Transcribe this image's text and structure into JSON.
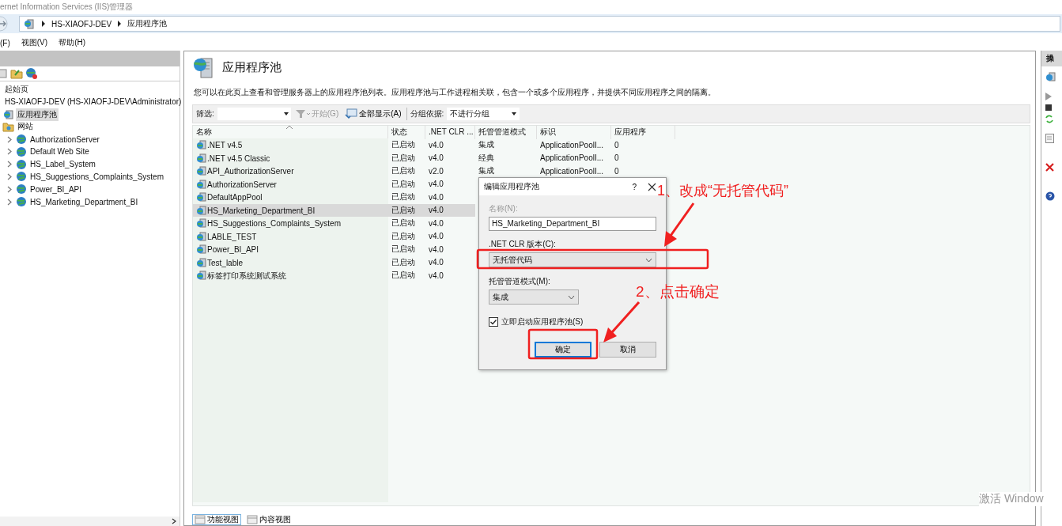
{
  "window": {
    "title": "ernet Information Services (IIS)管理器"
  },
  "address": {
    "segments": [
      "HS-XIAOFJ-DEV",
      "应用程序池"
    ]
  },
  "menu": [
    "(F)",
    "视图(V)",
    "帮助(H)"
  ],
  "tree": [
    {
      "label": "起始页",
      "selected": false
    },
    {
      "label": "HS-XIAOFJ-DEV (HS-XIAOFJ-DEV\\Administrator)",
      "selected": false,
      "children": [
        {
          "label": "应用程序池",
          "kind": "pools",
          "selected": true
        },
        {
          "label": "网站",
          "kind": "sites",
          "selected": false,
          "children": [
            {
              "label": "AuthorizationServer",
              "kind": "site",
              "selected": false,
              "expanded": false
            },
            {
              "label": "Default Web Site",
              "kind": "site",
              "selected": false,
              "expanded": false
            },
            {
              "label": "HS_Label_System",
              "kind": "site",
              "selected": false,
              "expanded": false
            },
            {
              "label": "HS_Suggestions_Complaints_System",
              "kind": "site",
              "selected": false,
              "expanded": false
            },
            {
              "label": "Power_BI_API",
              "kind": "site",
              "selected": false,
              "expanded": false
            },
            {
              "label": "HS_Marketing_Department_BI",
              "kind": "site",
              "selected": false,
              "expanded": false
            }
          ]
        }
      ]
    }
  ],
  "page": {
    "title": "应用程序池",
    "description": "您可以在此页上查看和管理服务器上的应用程序池列表。应用程序池与工作进程相关联，包含一个或多个应用程序，并提供不同应用程序之间的隔离。"
  },
  "filter": {
    "label": "筛选:",
    "buttons": [
      {
        "label": "开始(G)",
        "kind": "start",
        "disabled": true
      },
      {
        "label": "全部显示(A)",
        "kind": "show_all",
        "disabled": false
      }
    ],
    "group_label": "分组依据:",
    "group_value": "不进行分组"
  },
  "table": {
    "columns": [
      "名称",
      "状态",
      ".NET CLR ...",
      "托管管道模式",
      "标识",
      "应用程序"
    ],
    "rows": [
      {
        "cells": [
          ".NET v4.5",
          "已启动",
          "v4.0",
          "集成",
          "ApplicationPoolI...",
          "0"
        ],
        "selected": false
      },
      {
        "cells": [
          ".NET v4.5 Classic",
          "已启动",
          "v4.0",
          "经典",
          "ApplicationPoolI...",
          "0"
        ],
        "selected": false
      },
      {
        "cells": [
          "API_AuthorizationServer",
          "已启动",
          "v2.0",
          "集成",
          "ApplicationPoolI...",
          "0"
        ],
        "selected": false
      },
      {
        "cells": [
          "AuthorizationServer",
          "已启动",
          "v4.0"
        ],
        "selected": false
      },
      {
        "cells": [
          "DefaultAppPool",
          "已启动",
          "v4.0"
        ],
        "selected": false
      },
      {
        "cells": [
          "HS_Marketing_Department_BI",
          "已启动",
          "v4.0"
        ],
        "selected": true
      },
      {
        "cells": [
          "HS_Suggestions_Complaints_System",
          "已启动",
          "v4.0"
        ],
        "selected": false
      },
      {
        "cells": [
          "LABLE_TEST",
          "已启动",
          "v4.0"
        ],
        "selected": false
      },
      {
        "cells": [
          "Power_BI_API",
          "已启动",
          "v4.0"
        ],
        "selected": false
      },
      {
        "cells": [
          "Test_lable",
          "已启动",
          "v4.0"
        ],
        "selected": false
      },
      {
        "cells": [
          "标签打印系统测试系统",
          "已启动",
          "v4.0"
        ],
        "selected": false
      }
    ]
  },
  "view_tabs": [
    {
      "label": "功能视图",
      "selected": true
    },
    {
      "label": "内容视图",
      "selected": false
    }
  ],
  "actions": {
    "title": "操"
  },
  "dialog": {
    "title": "编辑应用程序池",
    "help": "?",
    "name": {
      "label": "名称(N):",
      "value": "HS_Marketing_Department_BI",
      "disabled": true
    },
    "clr": {
      "label": ".NET CLR 版本(C):",
      "value": "无托管代码"
    },
    "mode": {
      "label": "托管管道模式(M):",
      "value": "集成"
    },
    "autostart": {
      "label": "立即启动应用程序池(S)",
      "checked": true
    },
    "buttons": [
      {
        "label": "确定",
        "kind": "default"
      },
      {
        "label": "取消",
        "kind": "normal"
      }
    ]
  },
  "annotations": [
    {
      "text": "1、改成“无托管代码”"
    },
    {
      "text": "2、点击确定"
    }
  ],
  "activation": {
    "text": "激活 Window"
  }
}
